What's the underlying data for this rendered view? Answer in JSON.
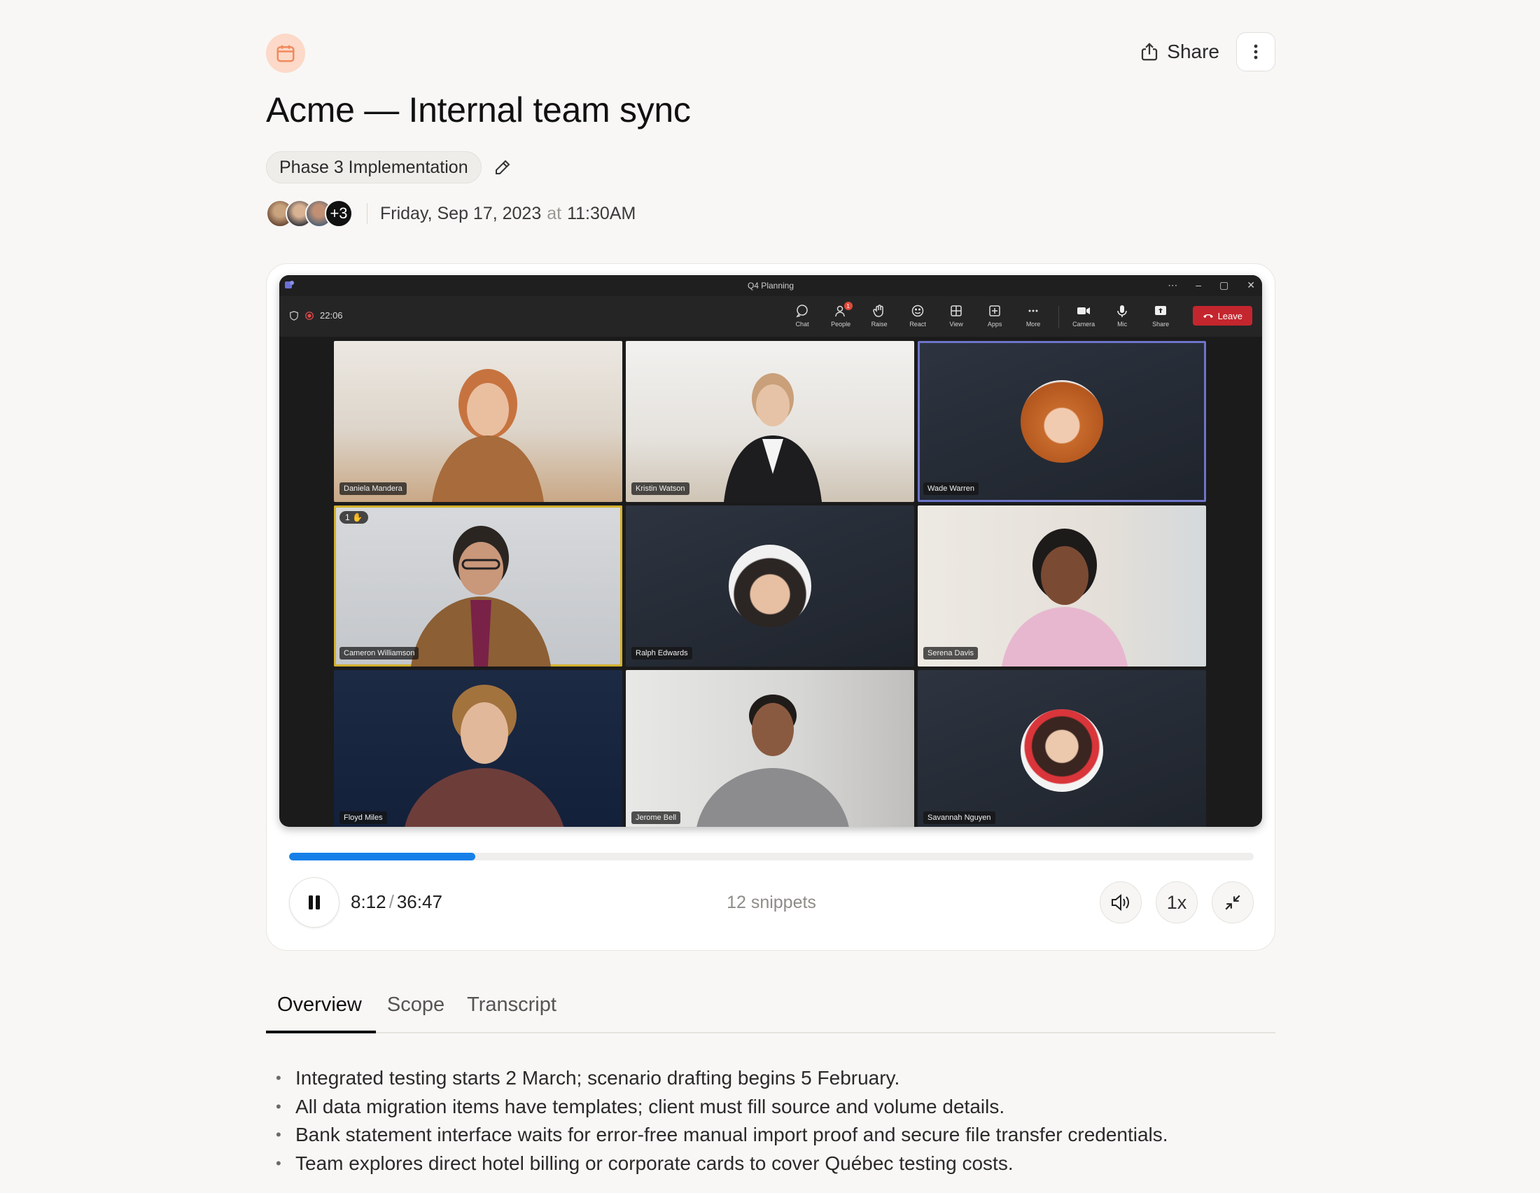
{
  "header": {
    "share_label": "Share",
    "title": "Acme — Internal team sync",
    "tag": "Phase 3 Implementation",
    "more_attendees": "+3",
    "date": "Friday, Sep 17, 2023",
    "at": "at",
    "time": "11:30AM"
  },
  "video": {
    "window_title": "Q4 Planning",
    "recording_time": "22:06",
    "toolbar": [
      {
        "label": "Chat",
        "icon": "chat-icon"
      },
      {
        "label": "People",
        "icon": "people-icon"
      },
      {
        "label": "Raise",
        "icon": "raise-hand-icon"
      },
      {
        "label": "React",
        "icon": "react-icon"
      },
      {
        "label": "View",
        "icon": "view-grid-icon"
      },
      {
        "label": "Apps",
        "icon": "apps-icon"
      },
      {
        "label": "More",
        "icon": "more-icon"
      },
      {
        "label": "Camera",
        "icon": "camera-icon"
      },
      {
        "label": "Mic",
        "icon": "mic-icon"
      },
      {
        "label": "Share",
        "icon": "share-screen-icon"
      }
    ],
    "people_badge": "1",
    "leave_label": "Leave",
    "raised_hand_count": "1",
    "participants": [
      {
        "name": "Daniela Mandera"
      },
      {
        "name": "Kristin Watson"
      },
      {
        "name": "Wade Warren"
      },
      {
        "name": "Cameron Williamson"
      },
      {
        "name": "Ralph Edwards"
      },
      {
        "name": "Serena Davis"
      },
      {
        "name": "Floyd Miles"
      },
      {
        "name": "Jerome Bell"
      },
      {
        "name": "Savannah Nguyen"
      }
    ]
  },
  "player": {
    "progress": 0.193,
    "current_time": "8:12",
    "total_time": "36:47",
    "snippets": "12 snippets",
    "speed": "1x",
    "accent_color": "#1680e8"
  },
  "tabs": [
    {
      "label": "Overview"
    },
    {
      "label": "Scope"
    },
    {
      "label": "Transcript"
    }
  ],
  "overview": [
    "Integrated testing starts 2 March; scenario drafting begins 5 February.",
    "All data migration items have templates; client must fill source and volume details.",
    "Bank statement interface waits for error-free manual import proof and secure file transfer credentials.",
    "Team explores direct hotel billing or corporate cards to cover Québec testing costs."
  ]
}
